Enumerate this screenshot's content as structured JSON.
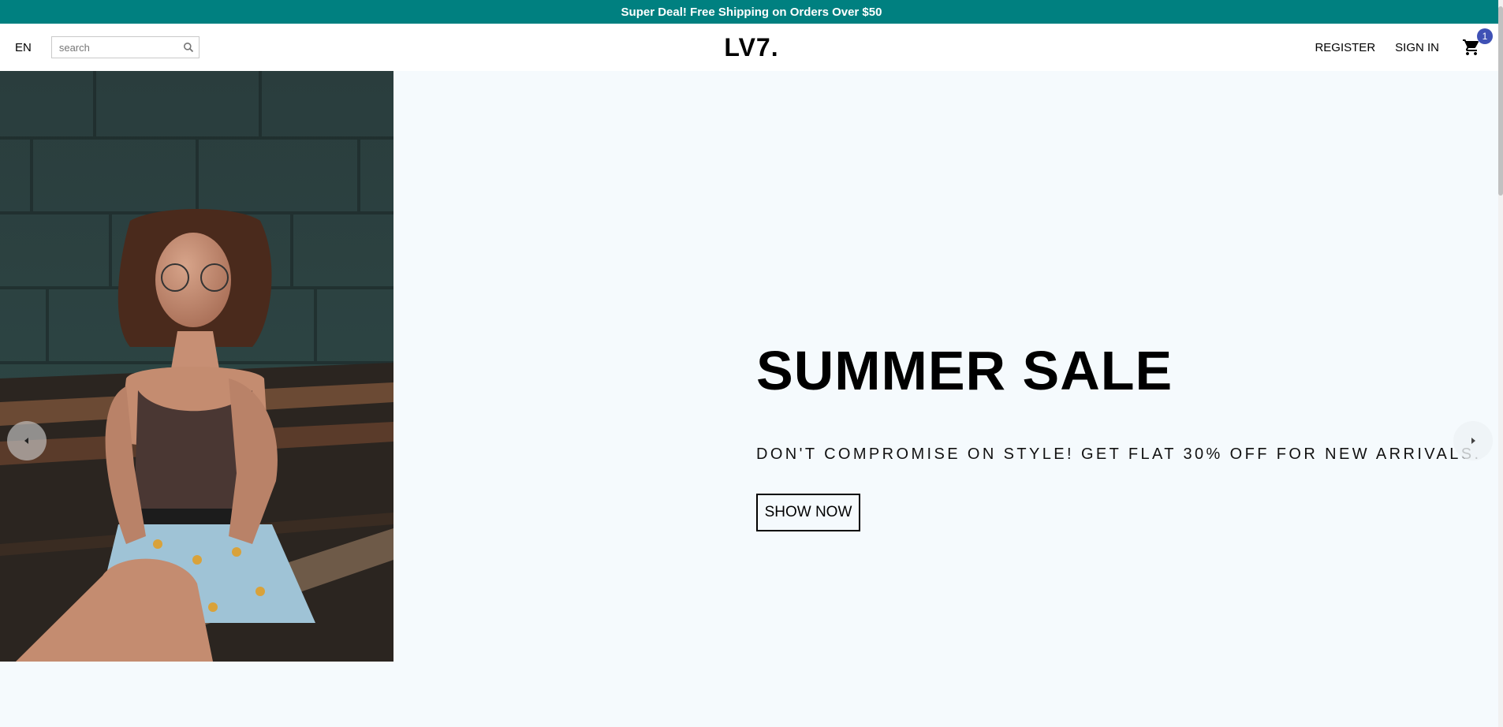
{
  "announcement": {
    "text": "Super Deal! Free Shipping on Orders Over $50",
    "background": "#008080"
  },
  "header": {
    "language": "EN",
    "search": {
      "placeholder": "search",
      "value": ""
    },
    "logo": "LV7.",
    "register": "REGISTER",
    "sign_in": "SIGN IN",
    "cart_count": "1",
    "badge_color": "#3f51b5"
  },
  "slide": {
    "title": "SUMMER SALE",
    "description": "DON'T COMPROMISE ON STYLE! GET FLAT 30% OFF FOR NEW ARRIVALS.",
    "button": "SHOW NOW",
    "background": "#f5fafd"
  }
}
